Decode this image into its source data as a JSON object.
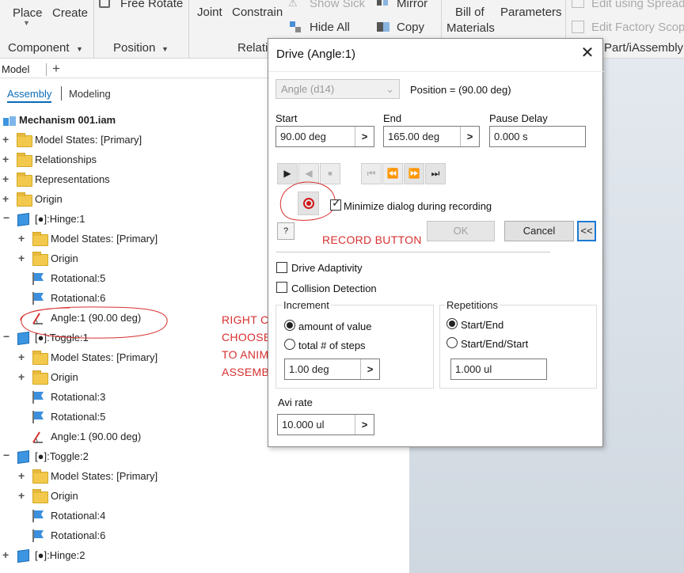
{
  "ribbon": {
    "place": "Place",
    "create": "Create",
    "free_rotate": "Free Rotate",
    "joint": "Joint",
    "constrain": "Constrain",
    "show_sick": "Show Sick",
    "hide_all": "Hide All",
    "mirror": "Mirror",
    "copy": "Copy",
    "bill_of_materials_1": "Bill of",
    "bill_of_materials_2": "Materials",
    "parameters": "Parameters",
    "edit_using_spread": "Edit using Spread",
    "edit_factory_scope": "Edit Factory Scope",
    "panel_component": "Component",
    "panel_position": "Position",
    "panel_relationships": "Relati",
    "panel_part_iassembly": "Part/iAssembly"
  },
  "browser": {
    "tab_model": "Model",
    "tab_plus": "+",
    "sub_assembly": "Assembly",
    "sub_modeling": "Modeling",
    "root": "Mechanism 001.iam",
    "rows": [
      {
        "label": "Model States: [Primary]"
      },
      {
        "label": "Relationships"
      },
      {
        "label": "Representations"
      },
      {
        "label": "Origin"
      },
      {
        "label": "[●]:Hinge:1"
      },
      {
        "label": "Model States: [Primary]"
      },
      {
        "label": "Origin"
      },
      {
        "label": "Rotational:5"
      },
      {
        "label": "Rotational:6"
      },
      {
        "label": "Angle:1 (90.00 deg)"
      },
      {
        "label": "[●]:Toggle:1"
      },
      {
        "label": "Model States: [Primary]"
      },
      {
        "label": "Origin"
      },
      {
        "label": "Rotational:3"
      },
      {
        "label": "Rotational:5"
      },
      {
        "label": "Angle:1 (90.00 deg)"
      },
      {
        "label": "[●]:Toggle:2"
      },
      {
        "label": "Model States: [Primary]"
      },
      {
        "label": "Origin"
      },
      {
        "label": "Rotational:4"
      },
      {
        "label": "Rotational:6"
      },
      {
        "label": "[●]:Hinge:2"
      }
    ]
  },
  "annotations": {
    "record_button": "RECORD BUTTON",
    "right_click_1": "RIGHT CLICK AND",
    "right_click_2": "CHOOSE DRIVE",
    "right_click_3": "TO ANIMATE YOUR",
    "right_click_4": "ASSEMBLY",
    "color": "#d83030"
  },
  "dialog": {
    "title": "Drive (Angle:1)",
    "close": "✕",
    "constraint_select": "Angle (d14)",
    "position": "Position = (90.00 deg)",
    "start_label": "Start",
    "start_value": "90.00 deg",
    "end_label": "End",
    "end_value": "165.00 deg",
    "pause_label": "Pause Delay",
    "pause_value": "0.000 s",
    "minimize_label": "Minimize dialog during recording",
    "minimize_checked": true,
    "help": "?",
    "ok": "OK",
    "cancel": "Cancel",
    "collapse": "<<",
    "drive_adaptivity": "Drive Adaptivity",
    "collision_detection": "Collision Detection",
    "increment_title": "Increment",
    "amount_of_value": "amount of value",
    "total_steps": "total # of steps",
    "increment_value": "1.00 deg",
    "repetitions_title": "Repetitions",
    "start_end": "Start/End",
    "start_end_start": "Start/End/Start",
    "repetitions_value": "1.000 ul",
    "avi_rate_label": "Avi rate",
    "avi_rate_value": "10.000 ul",
    "arrow": ">"
  }
}
